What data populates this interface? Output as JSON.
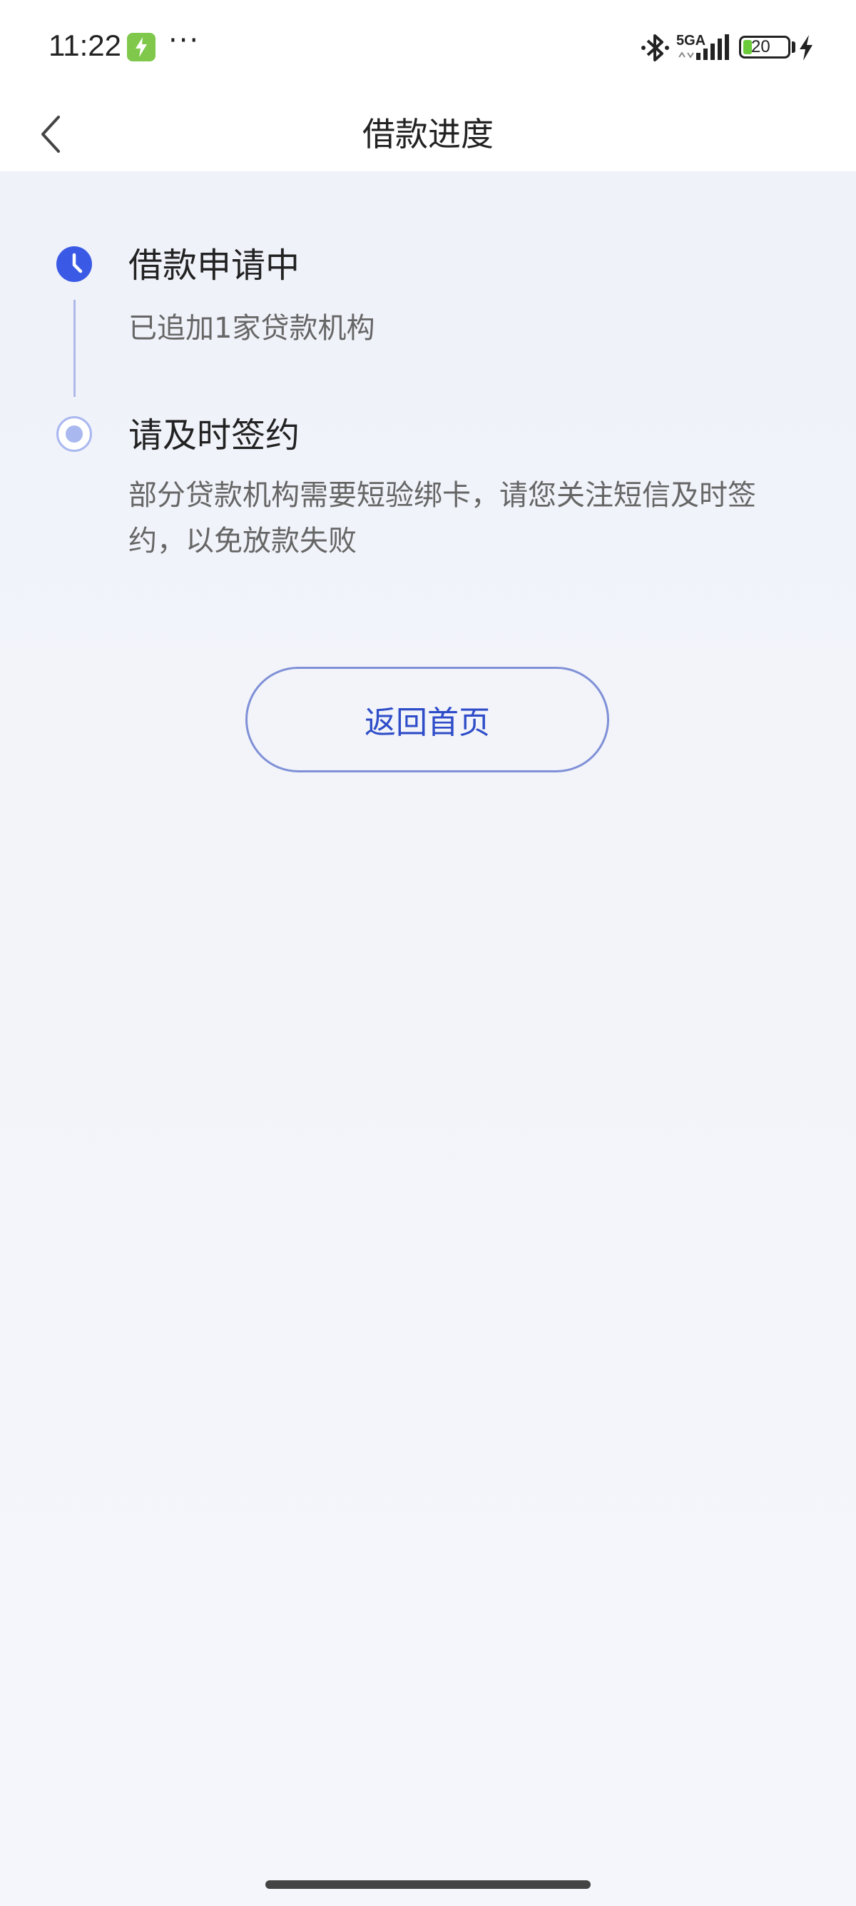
{
  "status_bar": {
    "time": "11:22",
    "more": "···",
    "network": "5GA",
    "battery": "20",
    "battery_fill_fraction": 0.2,
    "icons": [
      "charging-app-icon",
      "bluetooth-icon",
      "signal-icon",
      "battery-icon",
      "charging-bolt-icon"
    ]
  },
  "nav": {
    "back_icon": "chevron-left-icon",
    "title": "借款进度"
  },
  "steps": [
    {
      "icon": "clock-icon",
      "title": "借款申请中",
      "desc": "已追加1家贷款机构"
    },
    {
      "icon": "radio-dot-icon",
      "title": "请及时签约",
      "desc": "部分贷款机构需要短验绑卡，请您关注短信及时签约，以免放款失败"
    }
  ],
  "actions": {
    "home_label": "返回首页"
  },
  "colors": {
    "accent": "#3a5ae6",
    "accent_light": "#aab8f0",
    "button_border": "#7f90d6",
    "button_text": "#2f4dc8",
    "background": "#f2f4fa"
  }
}
